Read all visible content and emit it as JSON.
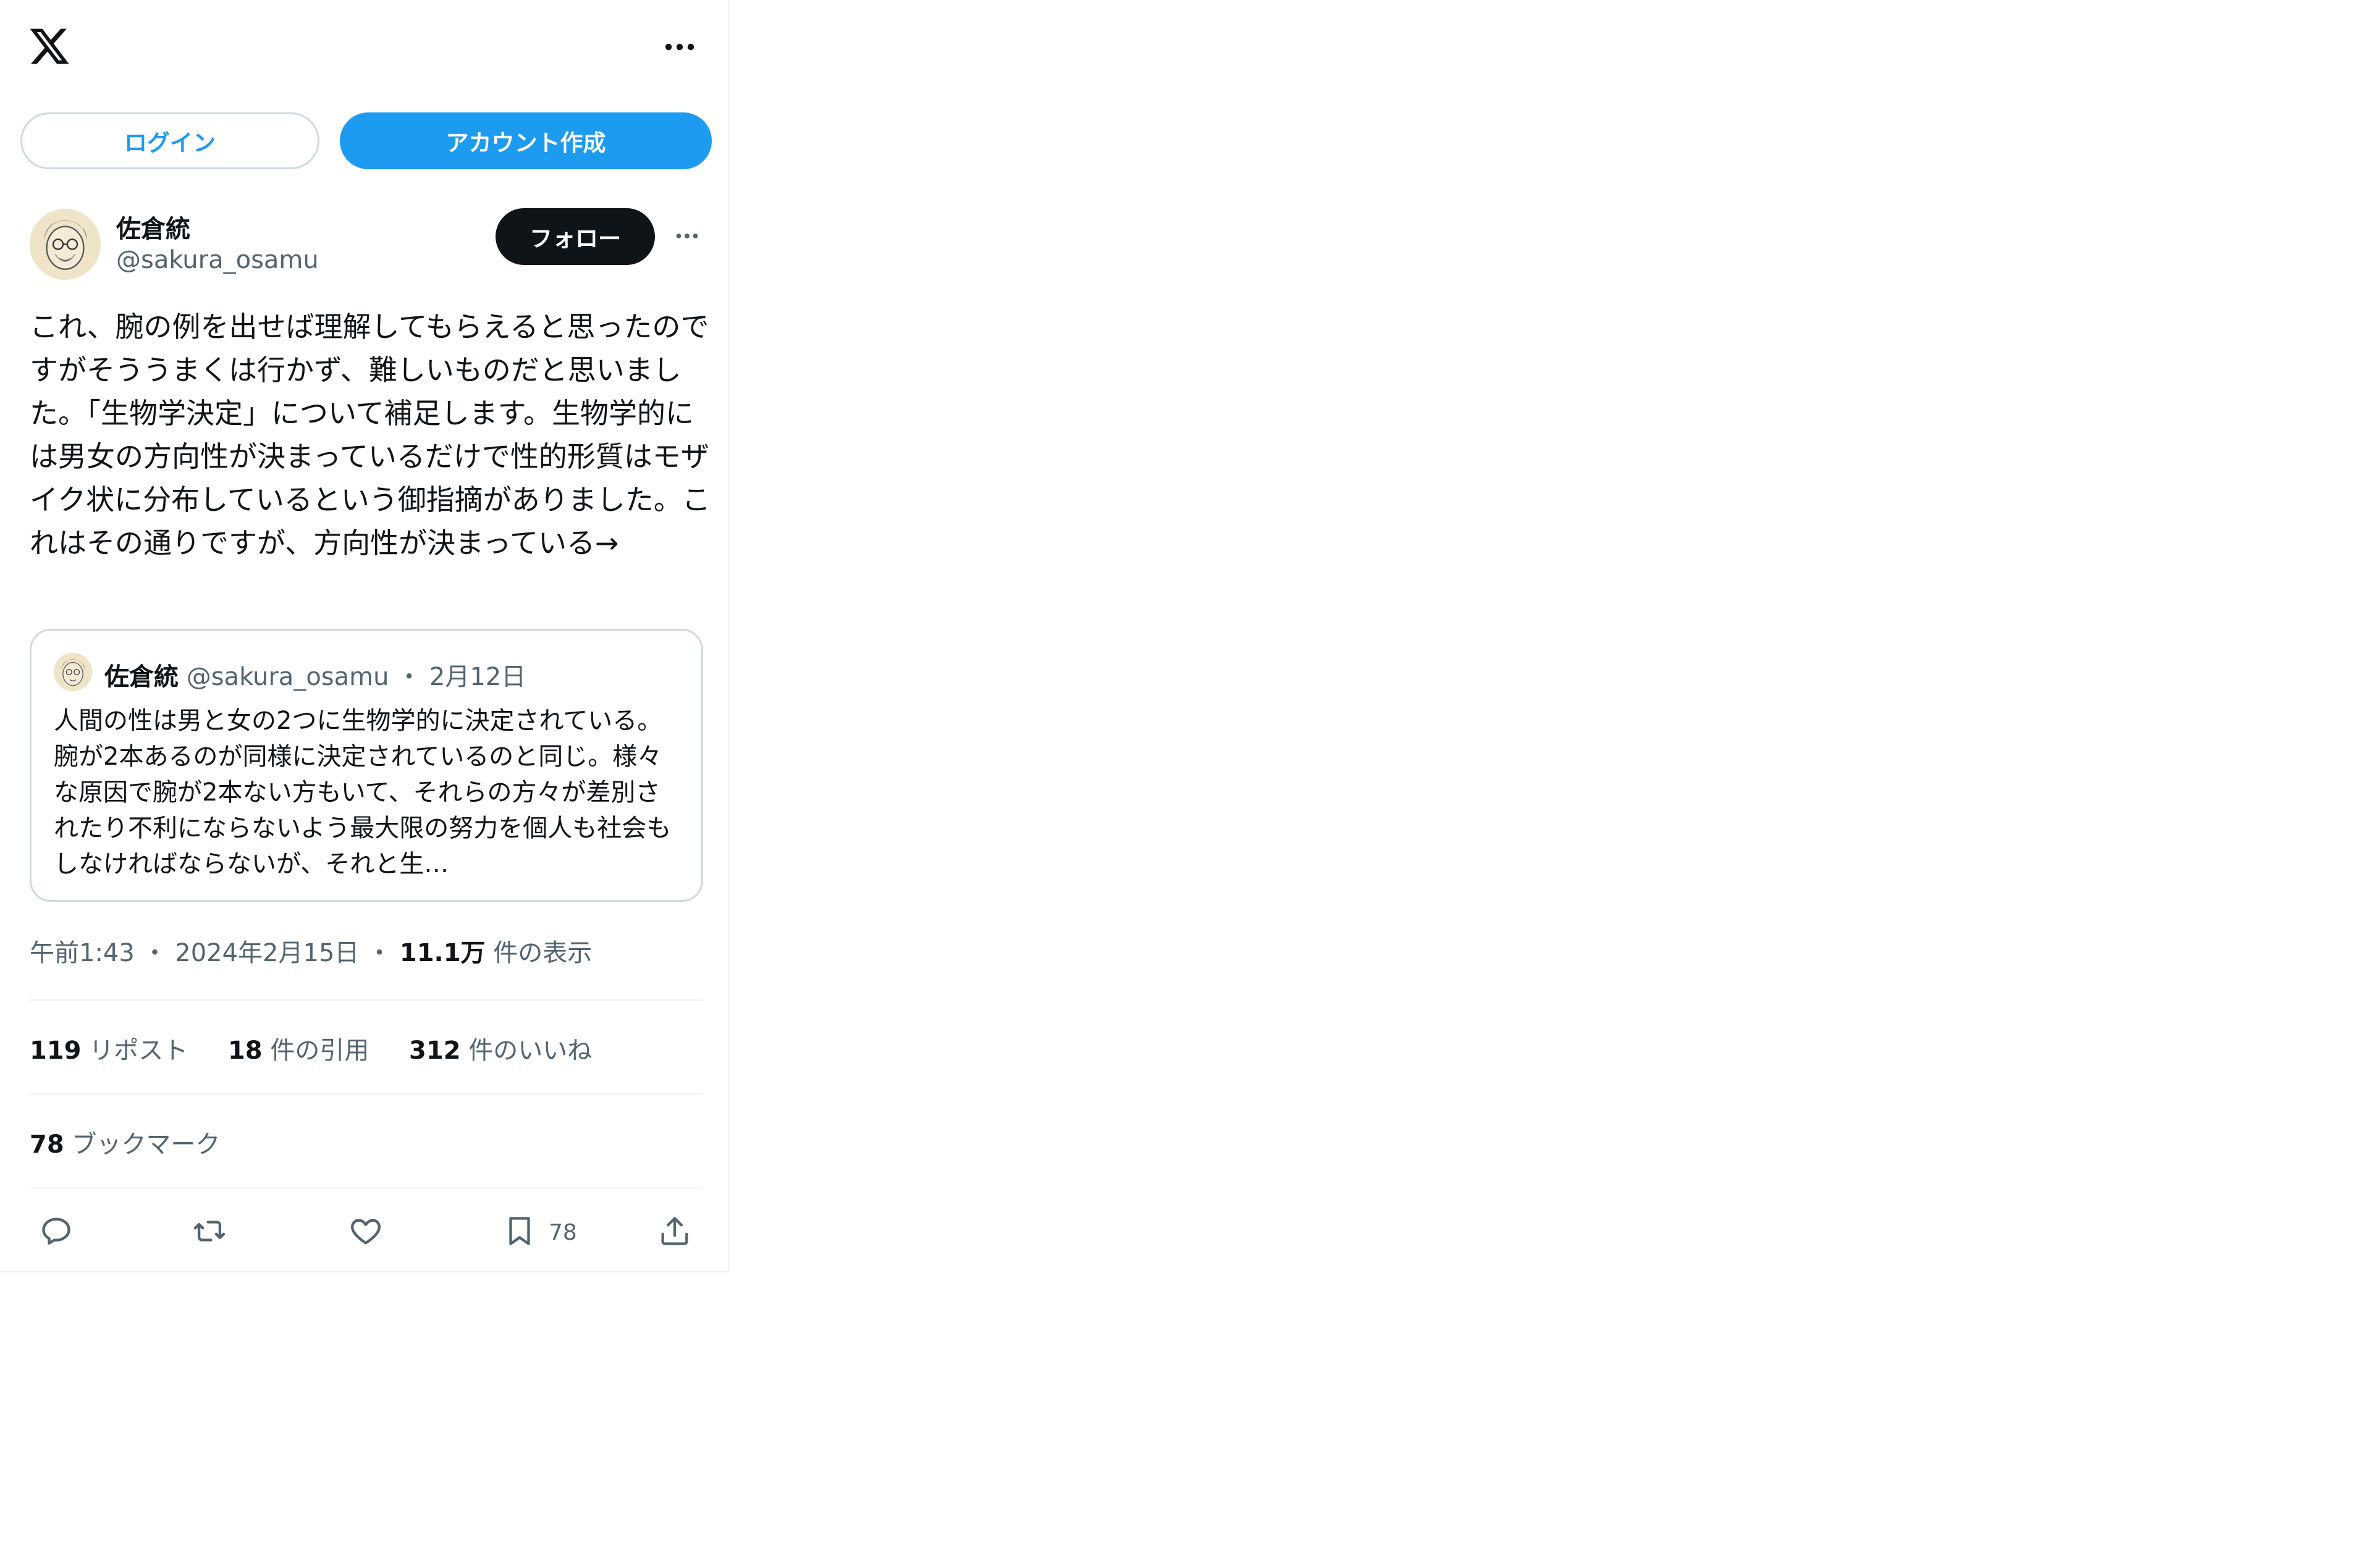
{
  "header": {
    "logo": "x-logo-icon",
    "more_icon": "more-horizontal-icon"
  },
  "auth": {
    "login_label": "ログイン",
    "create_account_label": "アカウント作成"
  },
  "tweet": {
    "author_name": "佐倉統",
    "author_handle": "@sakura_osamu",
    "follow_label": "フォロー",
    "text": "これ、腕の例を出せば理解してもらえると思ったのですがそううまくは行かず、難しいものだと思いました。「生物学決定」について補足します。生物学的には男女の方向性が決まっているだけで性的形質はモザイク状に分布しているという御指摘がありました。これはその通りですが、方向性が決まっている→",
    "time": "午前1:43",
    "date": "2024年2月15日",
    "views_count": "11.1万",
    "views_label": "件の表示"
  },
  "quote": {
    "author_name": "佐倉統",
    "author_handle": "@sakura_osamu",
    "separator": "・",
    "date": "2月12日",
    "text": "人間の性は男と女の2つに生物学的に決定されている。腕が2本あるのが同様に決定されているのと同じ。様々な原因で腕が2本ない方もいて、それらの方々が差別されたり不利にならないよう最大限の努力を個人も社会もしなければならないが、それと生…"
  },
  "stats": {
    "retweets_count": "119",
    "retweets_label": "リポスト",
    "quotes_count": "18",
    "quotes_label": "件の引用",
    "likes_count": "312",
    "likes_label": "件のいいね",
    "bookmarks_count": "78",
    "bookmarks_label": "ブックマーク"
  },
  "actions": {
    "reply_icon": "reply-icon",
    "retweet_icon": "retweet-icon",
    "like_icon": "heart-icon",
    "bookmark_icon": "bookmark-icon",
    "bookmark_count": "78",
    "share_icon": "share-icon"
  },
  "colors": {
    "accent": "#1d9bf0",
    "text": "#0f1419",
    "secondary": "#536471",
    "border": "#cfd9de"
  }
}
